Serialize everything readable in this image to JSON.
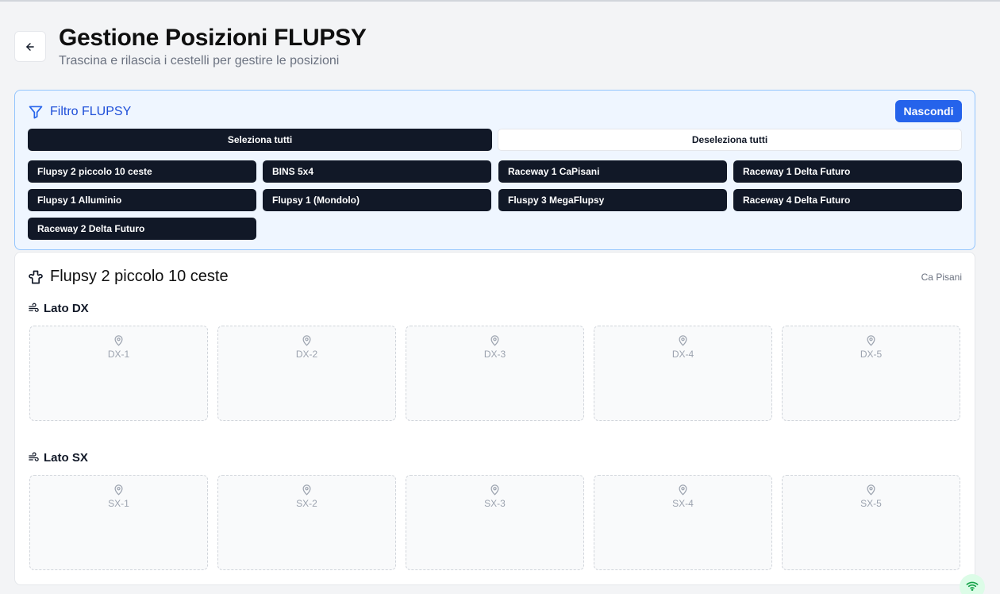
{
  "header": {
    "title": "Gestione Posizioni FLUPSY",
    "subtitle": "Trascina e rilascia i cestelli per gestire le posizioni",
    "back_icon": "arrow-left-icon"
  },
  "filter": {
    "title": "Filtro FLUPSY",
    "icon": "filter-icon",
    "hide_label": "Nascondi",
    "select_all_label": "Seleziona tutti",
    "deselect_all_label": "Deseleziona tutti",
    "chips": [
      "Flupsy 2 piccolo 10 ceste",
      "BINS 5x4",
      "Raceway 1 CaPisani",
      "Raceway 1 Delta Futuro",
      "Flupsy 1 Alluminio",
      "Flupsy 1 (Mondolo)",
      "Fluspy 3 MegaFlupsy",
      "Raceway 4 Delta Futuro",
      "Raceway 2 Delta Futuro"
    ]
  },
  "flupsy": {
    "name": "Flupsy 2 piccolo 10 ceste",
    "location": "Ca Pisani",
    "icon": "flupsy-icon",
    "sides": [
      {
        "label": "Lato DX",
        "icon": "wind-icon",
        "slots": [
          "DX-1",
          "DX-2",
          "DX-3",
          "DX-4",
          "DX-5"
        ]
      },
      {
        "label": "Lato SX",
        "icon": "wind-icon",
        "slots": [
          "SX-1",
          "SX-2",
          "SX-3",
          "SX-4",
          "SX-5"
        ]
      }
    ]
  },
  "status": {
    "icon": "wifi-icon",
    "color": "#16a34a"
  },
  "colors": {
    "accent": "#2563eb",
    "chip_bg": "#111827",
    "panel_bg": "#eff6ff"
  }
}
